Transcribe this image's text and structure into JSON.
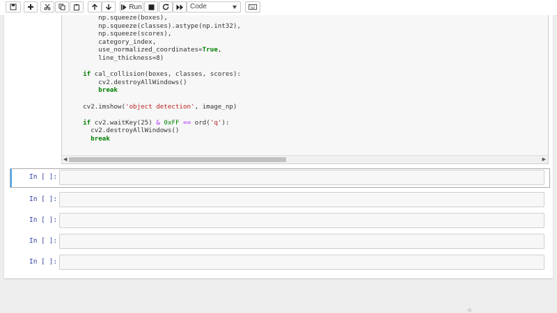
{
  "toolbar": {
    "buttons": [
      {
        "name": "save-button",
        "icon": "floppy-disk-icon"
      },
      {
        "name": "insert-cell-button",
        "icon": "plus-icon"
      },
      {
        "name": "cut-button",
        "icon": "scissors-icon"
      },
      {
        "name": "copy-button",
        "icon": "copy-icon"
      },
      {
        "name": "paste-button",
        "icon": "clipboard-icon"
      },
      {
        "name": "move-up-button",
        "icon": "arrow-up-icon"
      },
      {
        "name": "move-down-button",
        "icon": "arrow-down-icon"
      },
      {
        "name": "run-button",
        "icon": "step-forward-icon"
      },
      {
        "name": "interrupt-button",
        "icon": "stop-icon"
      },
      {
        "name": "restart-button",
        "icon": "refresh-icon"
      },
      {
        "name": "restart-run-all-button",
        "icon": "fast-forward-icon"
      },
      {
        "name": "command-palette-button",
        "icon": "keyboard-icon"
      }
    ],
    "run_label": "Run",
    "cell_type": "Code"
  },
  "code_lines": [
    "        np.squeeze(boxes),",
    "        np.squeeze(classes).astype(np.int32),",
    "        np.squeeze(scores),",
    "        category_index,",
    "        use_normalized_coordinates=True,",
    "        line_thickness=8)",
    "",
    "    if cal_collision(boxes, classes, scores):",
    "        cv2.destroyAllWindows()",
    "        break",
    "",
    "    cv2.imshow('object detection', image_np)",
    "",
    "    if cv2.waitKey(25) & 0xFF == ord('q'):",
    "      cv2.destroyAllWindows()",
    "      break"
  ],
  "empty_cells": [
    {
      "prompt": "In [ ]:",
      "selected": true
    },
    {
      "prompt": "In [ ]:",
      "selected": false
    },
    {
      "prompt": "In [ ]:",
      "selected": false
    },
    {
      "prompt": "In [ ]:",
      "selected": false
    },
    {
      "prompt": "In [ ]:",
      "selected": false
    }
  ],
  "colors": {
    "selected_bar": "#42a5f5",
    "prompt": "#303f9f",
    "keyword": "#008000",
    "string": "#ba2121"
  }
}
